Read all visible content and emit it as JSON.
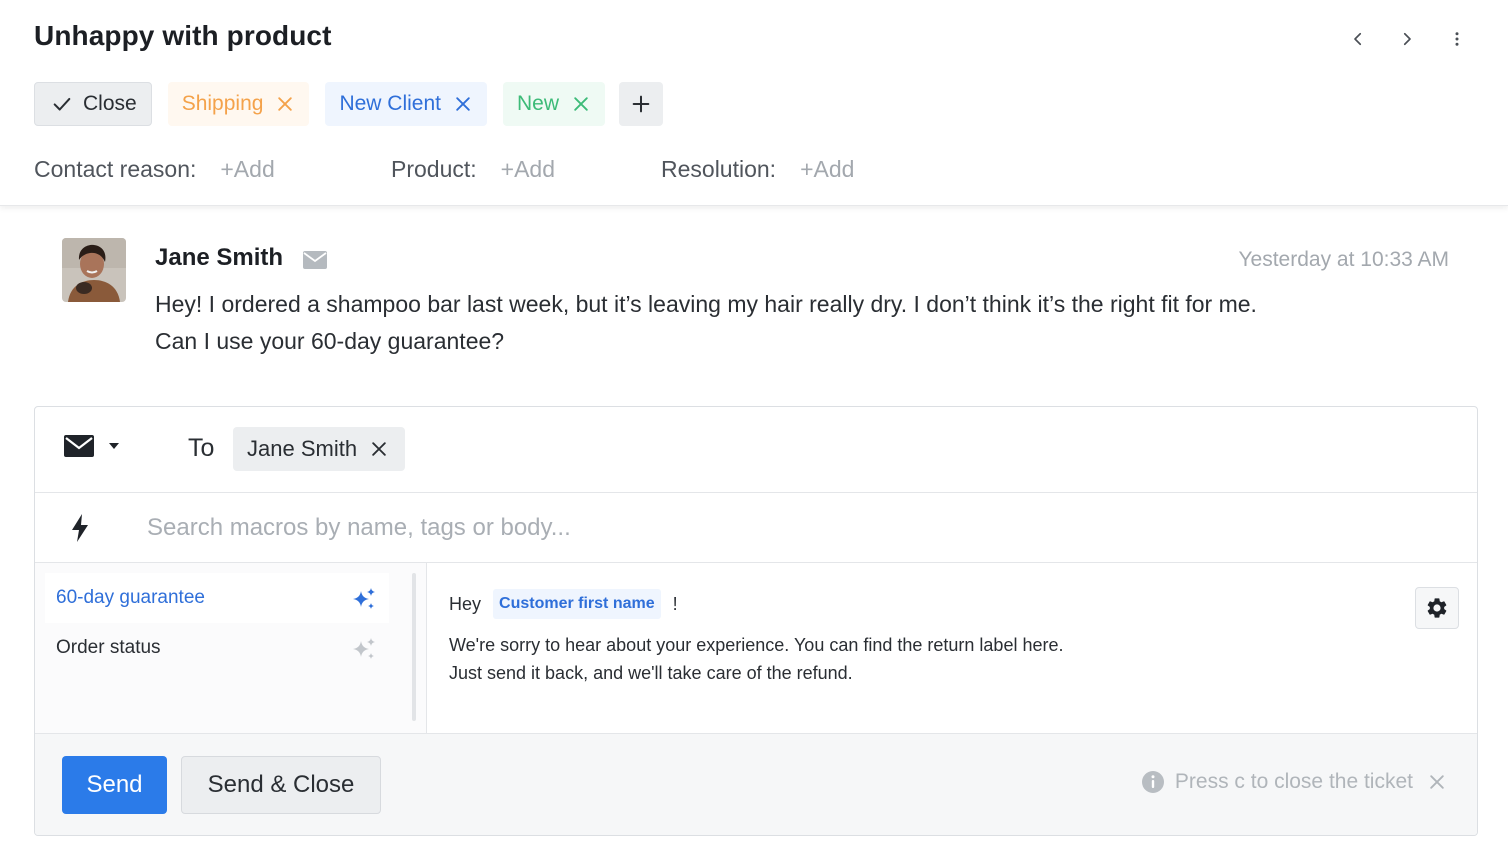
{
  "ticket": {
    "title": "Unhappy with product",
    "close_label": "Close",
    "tags": [
      {
        "label": "Shipping",
        "color": "#f4a24a"
      },
      {
        "label": "New Client",
        "color": "#2f6fd9"
      },
      {
        "label": "New",
        "color": "#3dbb78"
      }
    ],
    "fields": [
      {
        "label": "Contact reason:",
        "action": "+Add"
      },
      {
        "label": "Product:",
        "action": "+Add"
      },
      {
        "label": "Resolution:",
        "action": "+Add"
      }
    ]
  },
  "message": {
    "sender": "Jane Smith",
    "timestamp": "Yesterday at 10:33 AM",
    "body_line1": "Hey! I ordered a shampoo bar last week, but it’s leaving my hair really dry. I don’t think it’s the right fit for me.",
    "body_line2": "Can I use your 60-day guarantee?"
  },
  "reply": {
    "to_label": "To",
    "recipient": "Jane Smith",
    "macro_search_placeholder": "Search macros by name, tags or body...",
    "macros": [
      {
        "label": "60-day guarantee",
        "active": true
      },
      {
        "label": "Order status",
        "active": false
      }
    ],
    "preview": {
      "greeting": "Hey",
      "variable": "Customer first name",
      "punct": "!",
      "line1": "We're sorry to hear about your experience. You can find the return label here.",
      "line2": "Just send it back, and we'll take care of the refund."
    },
    "send_label": "Send",
    "send_close_label": "Send & Close",
    "hint": "Press c to close the ticket"
  },
  "colors": {
    "accent": "#2b7be9",
    "link_blue": "#2f6fd9"
  }
}
